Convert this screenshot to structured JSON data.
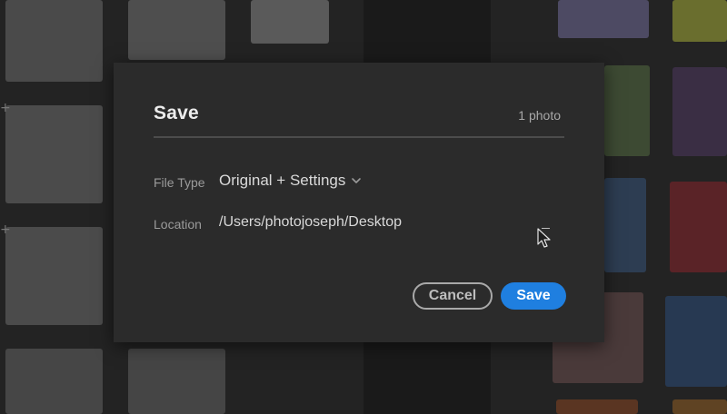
{
  "dialog": {
    "title": "Save",
    "photo_count": "1 photo",
    "file_type": {
      "label": "File Type",
      "value": "Original + Settings"
    },
    "location": {
      "label": "Location",
      "value": "/Users/photojoseph/Desktop"
    },
    "buttons": {
      "cancel": "Cancel",
      "save": "Save"
    }
  },
  "colors": {
    "dialog_bg": "#2b2b2b",
    "accent": "#1f7fe0",
    "text_primary": "#d9d9d9",
    "text_secondary": "#9b9b9b"
  }
}
